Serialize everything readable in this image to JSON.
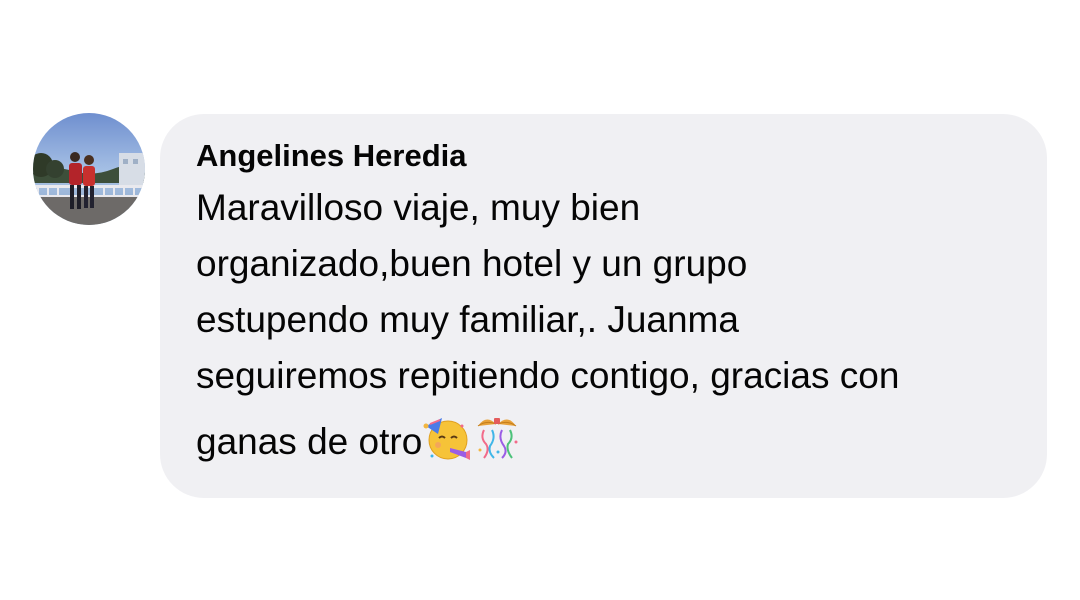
{
  "comment": {
    "author": "Angelines Heredia",
    "lines": [
      "Maravilloso viaje, muy bien",
      "organizado,buen hotel y un grupo",
      "estupendo muy familiar,. Juanma",
      "seguiremos repitiendo contigo, gracias con",
      "ganas de otro"
    ],
    "emojis": [
      "partying-face-icon",
      "confetti-ball-icon"
    ]
  },
  "colors": {
    "bubble": "#f0f0f3",
    "text": "#050505",
    "background": "#ffffff"
  }
}
